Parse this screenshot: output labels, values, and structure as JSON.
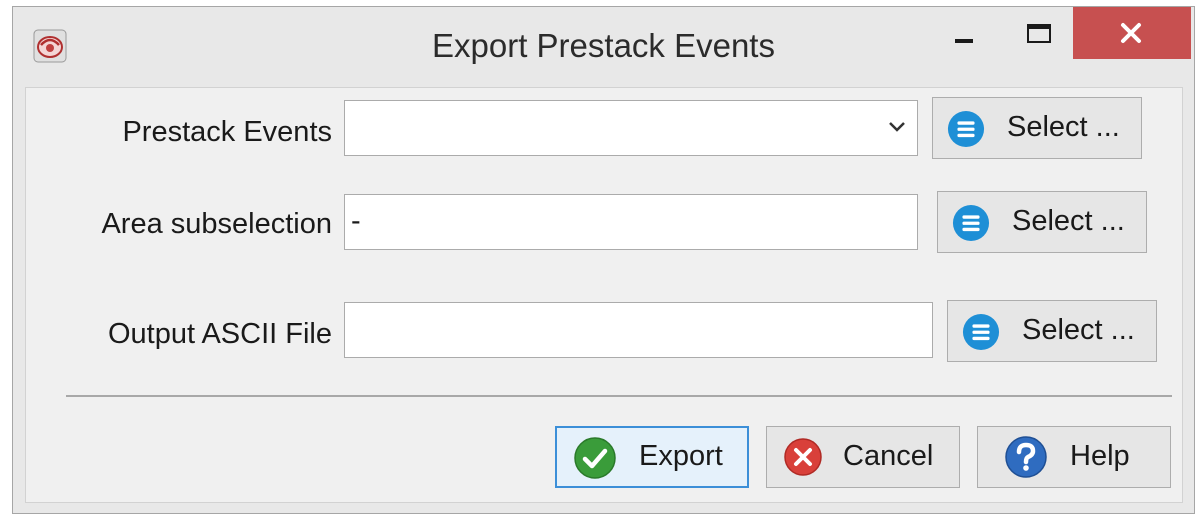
{
  "window": {
    "title": "Export Prestack Events"
  },
  "icons": {
    "app": "app-logo-icon",
    "minimize": "minimize-icon",
    "maximize": "maximize-icon",
    "close": "close-icon",
    "list": "list-icon",
    "dropdown": "chevron-down-icon",
    "export": "checkmark-icon",
    "cancel": "cancel-icon",
    "help": "help-icon"
  },
  "colors": {
    "close_button": "#c75050",
    "list_icon": "#1e8fd6",
    "export_icon": "#3a9c3a",
    "cancel_icon": "#d9403a",
    "help_icon": "#2f6cc0",
    "default_button_border": "#3c8fd8"
  },
  "form": {
    "prestack_events": {
      "label": "Prestack Events",
      "value": "",
      "select_label": "Select ..."
    },
    "area_subselection": {
      "label": "Area subselection",
      "value": "-",
      "select_label": "Select ..."
    },
    "output_ascii_file": {
      "label": "Output ASCII File",
      "value": "",
      "select_label": "Select ..."
    }
  },
  "buttons": {
    "export": "Export",
    "cancel": "Cancel",
    "help": "Help"
  }
}
